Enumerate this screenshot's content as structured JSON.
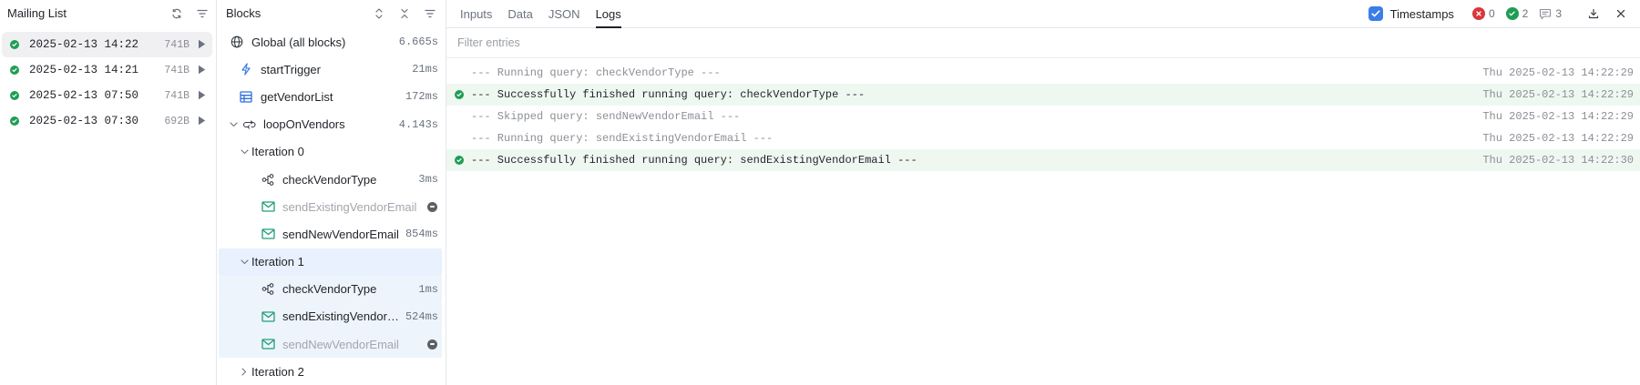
{
  "runs_panel": {
    "title": "Mailing List",
    "runs": [
      {
        "date": "2025-02-13 14:22",
        "size": "741B",
        "status": "success",
        "selected": true
      },
      {
        "date": "2025-02-13 14:21",
        "size": "741B",
        "status": "success",
        "selected": false
      },
      {
        "date": "2025-02-13 07:50",
        "size": "741B",
        "status": "success",
        "selected": false
      },
      {
        "date": "2025-02-13 07:30",
        "size": "692B",
        "status": "success",
        "selected": false
      }
    ]
  },
  "blocks_panel": {
    "title": "Blocks",
    "rows": [
      {
        "label": "Global (all blocks)",
        "time": "6.665s",
        "icon": "globe-icon"
      },
      {
        "label": "startTrigger",
        "time": "21ms",
        "icon": "lightning-icon"
      },
      {
        "label": "getVendorList",
        "time": "172ms",
        "icon": "table-icon"
      },
      {
        "label": "loopOnVendors",
        "time": "4.143s",
        "icon": "loop-icon"
      },
      {
        "label": "Iteration 0",
        "time": ""
      },
      {
        "label": "checkVendorType",
        "time": "3ms",
        "icon": "branch-icon"
      },
      {
        "label": "sendExistingVendorEmail",
        "time": "",
        "icon": "mail-icon",
        "skipped": true
      },
      {
        "label": "sendNewVendorEmail",
        "time": "854ms",
        "icon": "mail-icon"
      },
      {
        "label": "Iteration 1",
        "time": ""
      },
      {
        "label": "checkVendorType",
        "time": "1ms",
        "icon": "branch-icon"
      },
      {
        "label": "sendExistingVendorEmail",
        "time": "524ms",
        "icon": "mail-icon"
      },
      {
        "label": "sendNewVendorEmail",
        "time": "",
        "icon": "mail-icon",
        "skipped": true
      },
      {
        "label": "Iteration 2",
        "time": ""
      }
    ]
  },
  "logs_panel": {
    "tabs": [
      {
        "label": "Inputs",
        "active": false
      },
      {
        "label": "Data",
        "active": false
      },
      {
        "label": "JSON",
        "active": false
      },
      {
        "label": "Logs",
        "active": true
      }
    ],
    "timestamps_label": "Timestamps",
    "timestamps_checked": true,
    "error_count": "0",
    "success_count": "2",
    "message_count": "3",
    "filter_placeholder": "Filter entries",
    "entries": [
      {
        "message": "--- Running query: checkVendorType ---",
        "time": "Thu 2025-02-13 14:22:29",
        "status": "info"
      },
      {
        "message": "--- Successfully finished running query: checkVendorType ---",
        "time": "Thu 2025-02-13 14:22:29",
        "status": "success"
      },
      {
        "message": "--- Skipped query: sendNewVendorEmail ---",
        "time": "Thu 2025-02-13 14:22:29",
        "status": "info"
      },
      {
        "message": "--- Running query: sendExistingVendorEmail ---",
        "time": "Thu 2025-02-13 14:22:29",
        "status": "info"
      },
      {
        "message": "--- Successfully finished running query: sendExistingVendorEmail ---",
        "time": "Thu 2025-02-13 14:22:30",
        "status": "success"
      }
    ]
  },
  "colors": {
    "success": "#1f9d55",
    "error": "#d9363e",
    "accent": "#3b7ee8",
    "selection": "#e8f1fd"
  }
}
